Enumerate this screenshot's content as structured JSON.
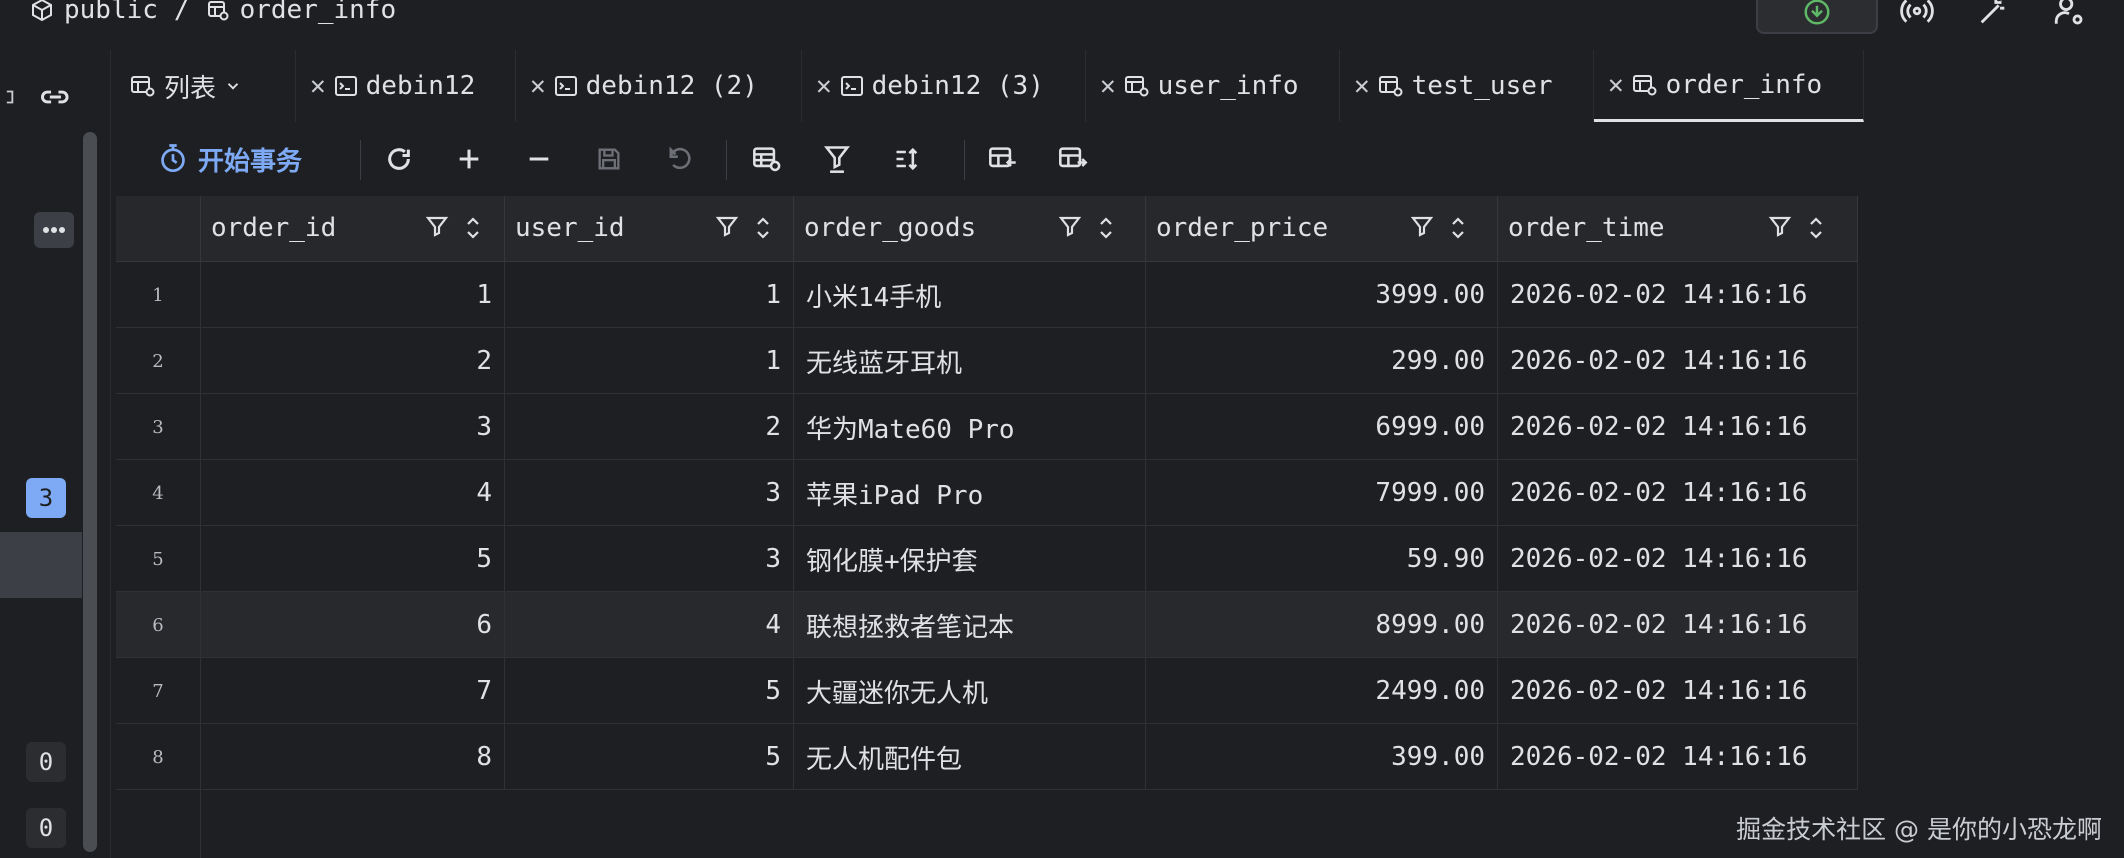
{
  "breadcrumb": {
    "schema": "public",
    "separator": "/",
    "table": "order_info"
  },
  "tabs": [
    {
      "label": "列表",
      "icon": "table-icon",
      "closable": false,
      "dropdown": true
    },
    {
      "label": "debin12",
      "icon": "terminal-icon",
      "closable": true
    },
    {
      "label": "debin12 (2)",
      "icon": "terminal-icon",
      "closable": true
    },
    {
      "label": "debin12 (3)",
      "icon": "terminal-icon",
      "closable": true
    },
    {
      "label": "user_info",
      "icon": "table-icon",
      "closable": true
    },
    {
      "label": "test_user",
      "icon": "table-icon",
      "closable": true
    },
    {
      "label": "order_info",
      "icon": "table-icon",
      "closable": true,
      "active": true
    }
  ],
  "toolbar": {
    "transaction_label": "开始事务"
  },
  "sidebar": {
    "badge_active": "3",
    "badge_a": "0",
    "badge_b": "0"
  },
  "table": {
    "columns": [
      "order_id",
      "user_id",
      "order_goods",
      "order_price",
      "order_time"
    ],
    "rows": [
      {
        "n": "1",
        "order_id": "1",
        "user_id": "1",
        "order_goods": "小米14手机",
        "order_price": "3999.00",
        "order_time": "2026-02-02 14:16:16"
      },
      {
        "n": "2",
        "order_id": "2",
        "user_id": "1",
        "order_goods": "无线蓝牙耳机",
        "order_price": "299.00",
        "order_time": "2026-02-02 14:16:16"
      },
      {
        "n": "3",
        "order_id": "3",
        "user_id": "2",
        "order_goods": "华为Mate60 Pro",
        "order_price": "6999.00",
        "order_time": "2026-02-02 14:16:16"
      },
      {
        "n": "4",
        "order_id": "4",
        "user_id": "3",
        "order_goods": "苹果iPad Pro",
        "order_price": "7999.00",
        "order_time": "2026-02-02 14:16:16"
      },
      {
        "n": "5",
        "order_id": "5",
        "user_id": "3",
        "order_goods": "钢化膜+保护套",
        "order_price": "59.90",
        "order_time": "2026-02-02 14:16:16"
      },
      {
        "n": "6",
        "order_id": "6",
        "user_id": "4",
        "order_goods": "联想拯救者笔记本",
        "order_price": "8999.00",
        "order_time": "2026-02-02 14:16:16"
      },
      {
        "n": "7",
        "order_id": "7",
        "user_id": "5",
        "order_goods": "大疆迷你无人机",
        "order_price": "2499.00",
        "order_time": "2026-02-02 14:16:16"
      },
      {
        "n": "8",
        "order_id": "8",
        "user_id": "5",
        "order_goods": "无人机配件包",
        "order_price": "399.00",
        "order_time": "2026-02-02 14:16:16"
      }
    ]
  },
  "watermark": "掘金技术社区 @ 是你的小恐龙啊",
  "colors": {
    "background": "#1e1f22",
    "header": "#26282b",
    "accent": "#7eaaf5",
    "run_green": "#5fb865"
  }
}
